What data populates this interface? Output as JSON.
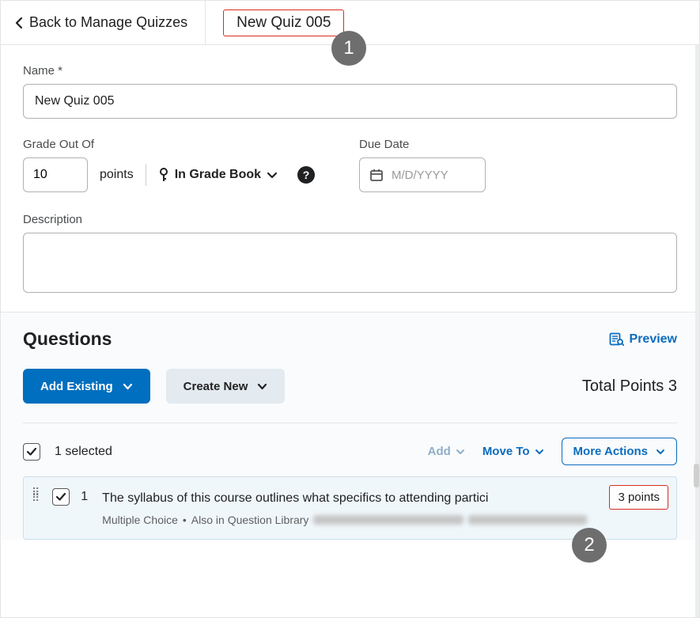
{
  "header": {
    "back_label": "Back to Manage Quizzes",
    "quiz_title": "New Quiz 005"
  },
  "callouts": {
    "one": "1",
    "two": "2"
  },
  "fields": {
    "name_label": "Name *",
    "name_value": "New Quiz 005",
    "grade_label": "Grade Out Of",
    "grade_value": "10",
    "points_word": "points",
    "gradebook_label": "In Grade Book",
    "due_label": "Due Date",
    "due_placeholder": "M/D/YYYY",
    "desc_label": "Description"
  },
  "questions": {
    "heading": "Questions",
    "preview": "Preview",
    "add_existing": "Add Existing",
    "create_new": "Create New",
    "total_points_label": "Total Points 3",
    "selected_text": "1 selected",
    "add_action": "Add",
    "move_action": "Move To",
    "more_actions": "More Actions",
    "item": {
      "number": "1",
      "text": "The syllabus of this course outlines what specifics to attending partici",
      "type": "Multiple Choice",
      "library": "Also in Question Library",
      "points": "3 points"
    }
  }
}
